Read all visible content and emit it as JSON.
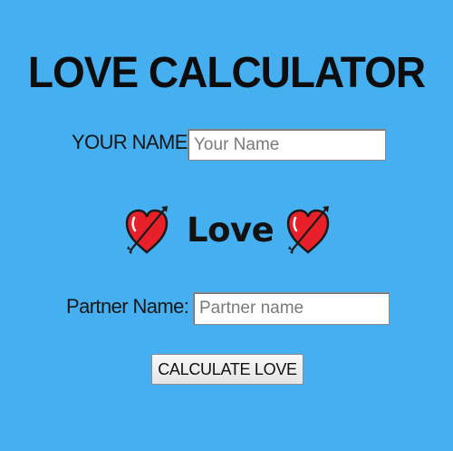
{
  "title": "LOVE CALCULATOR",
  "your_name": {
    "label": "YOUR NAME",
    "value": "",
    "placeholder": "Your Name"
  },
  "love_banner": {
    "text": "Love",
    "left_icon": "heart-arrow-icon",
    "right_icon": "heart-arrow-icon"
  },
  "partner_name": {
    "label": "Partner Name:",
    "value": "",
    "placeholder": "Partner name"
  },
  "calculate_button": {
    "label": "CALCULATE LOVE"
  },
  "colors": {
    "background": "#45aff0",
    "heart": "#e8202a",
    "text": "#111111"
  }
}
